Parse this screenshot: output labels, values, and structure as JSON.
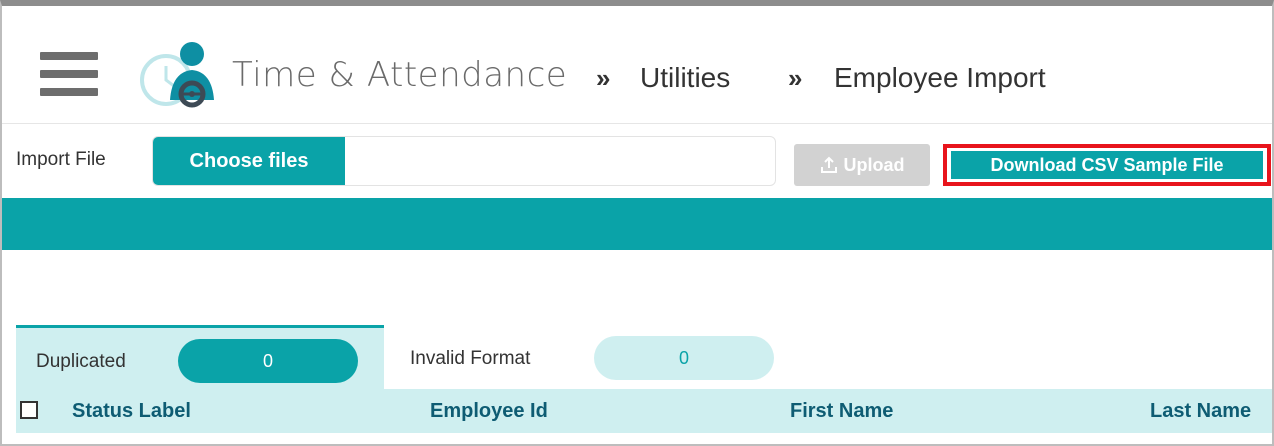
{
  "header": {
    "app_title": "Time & Attendance",
    "separator": "»",
    "breadcrumbs": [
      "Utilities",
      "Employee Import"
    ]
  },
  "import": {
    "label": "Import File",
    "choose_label": "Choose files",
    "upload_label": "Upload",
    "download_label": "Download CSV Sample File"
  },
  "tabs": [
    {
      "label": "Duplicated",
      "count": "0",
      "active": true
    },
    {
      "label": "Invalid Format",
      "count": "0",
      "active": false
    }
  ],
  "table": {
    "columns": [
      "Status Label",
      "Employee Id",
      "First Name",
      "Last Name"
    ]
  },
  "colors": {
    "accent": "#0aa3a8",
    "accent_light": "#cfeff0",
    "highlight": "#e8141c",
    "header_text": "#0e5c73"
  },
  "icons": [
    "menu-icon",
    "app-logo",
    "upload-icon"
  ]
}
